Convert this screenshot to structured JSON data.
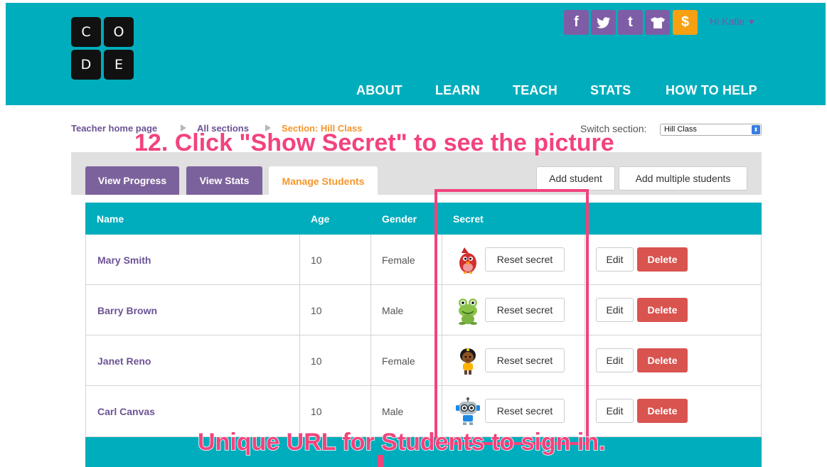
{
  "logo": {
    "letters": [
      "C",
      "O",
      "D",
      "E"
    ]
  },
  "header": {
    "social": [
      {
        "icon": "facebook-icon",
        "glyph": "f"
      },
      {
        "icon": "twitter-icon",
        "glyph": "🐦"
      },
      {
        "icon": "tumblr-icon",
        "glyph": "t"
      },
      {
        "icon": "shirt-icon",
        "glyph": "👕"
      },
      {
        "icon": "donate-icon",
        "glyph": "$"
      }
    ],
    "user_greeting": "Hi Katie",
    "user_caret": "▼",
    "nav": [
      "ABOUT",
      "LEARN",
      "TEACH",
      "STATS",
      "HOW TO HELP"
    ]
  },
  "breadcrumb": {
    "home": "Teacher home page",
    "sections": "All sections",
    "current": "Section: Hill Class"
  },
  "switch_section": {
    "label": "Switch section:",
    "value": "Hill Class"
  },
  "tabs": [
    "View Progress",
    "View Stats",
    "Manage Students"
  ],
  "actions": {
    "add_student": "Add student",
    "add_multiple": "Add multiple students"
  },
  "table": {
    "headers": {
      "name": "Name",
      "age": "Age",
      "gender": "Gender",
      "secret": "Secret"
    },
    "reset_label": "Reset secret",
    "edit_label": "Edit",
    "delete_label": "Delete",
    "rows": [
      {
        "name": "Mary Smith",
        "age": "10",
        "gender": "Female",
        "secret_icon": "cardinal-icon"
      },
      {
        "name": "Barry Brown",
        "age": "10",
        "gender": "Male",
        "secret_icon": "frog-icon"
      },
      {
        "name": "Janet Reno",
        "age": "10",
        "gender": "Female",
        "secret_icon": "girl-icon"
      },
      {
        "name": "Carl Canvas",
        "age": "10",
        "gender": "Male",
        "secret_icon": "robot-icon"
      }
    ]
  },
  "annotations": {
    "top": "12. Click \"Show Secret\" to see the picture",
    "bottom": "Unique URL for Students to sign in."
  },
  "colors": {
    "header_bg": "#00adbc",
    "purple": "#7c629c",
    "orange": "#f4962d",
    "delete_red": "#d9534f",
    "annotation_pink": "#f2437c"
  }
}
